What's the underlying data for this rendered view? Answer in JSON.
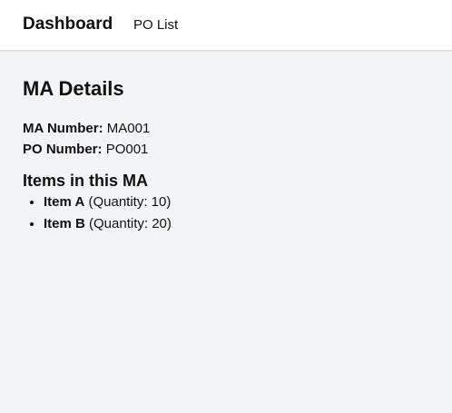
{
  "navbar": {
    "brand": "Dashboard",
    "links": [
      {
        "label": "PO List"
      }
    ]
  },
  "details": {
    "title": "MA Details",
    "ma_number_label": "MA Number:",
    "ma_number_value": "MA001",
    "po_number_label": "PO Number:",
    "po_number_value": "PO001"
  },
  "items_section": {
    "title": "Items in this MA",
    "items": [
      {
        "name": "Item A",
        "quantity_text": "(Quantity: 10)"
      },
      {
        "name": "Item B",
        "quantity_text": "(Quantity: 20)"
      }
    ]
  }
}
